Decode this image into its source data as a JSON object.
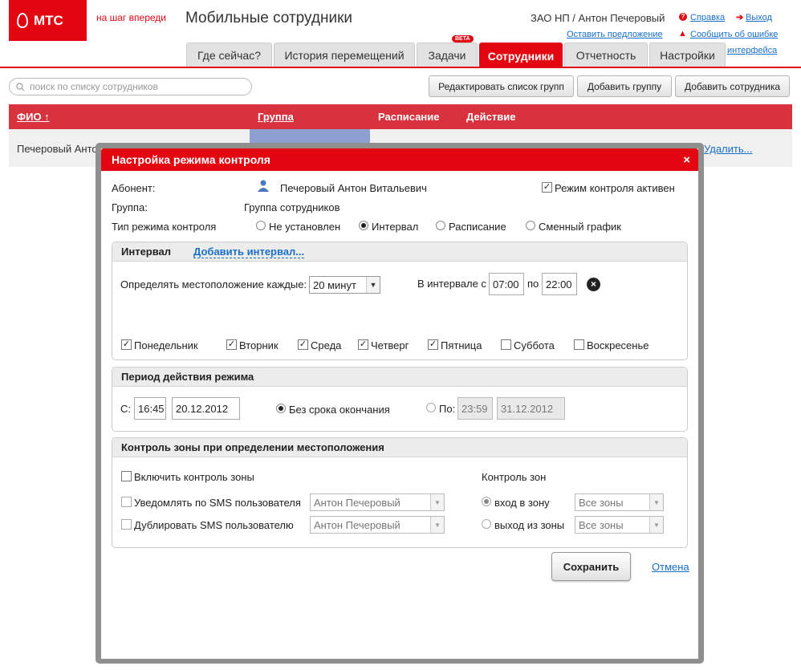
{
  "header": {
    "logo_text": "МТС",
    "slogan": "на шаг впереди",
    "app_title": "Мобильные сотрудники",
    "company_user": "ЗАО НП / Антон Печеровый",
    "help": "Справка",
    "logout": "Выход",
    "suggest": "Оставить предложение",
    "report_error": "Сообщить об ошибке",
    "interface_partial": "интерфейса"
  },
  "tabs": [
    {
      "label": "Где сейчас?"
    },
    {
      "label": "История перемещений"
    },
    {
      "label": "Задачи",
      "badge": "BETA"
    },
    {
      "label": "Сотрудники",
      "active": true
    },
    {
      "label": "Отчетность"
    },
    {
      "label": "Настройки"
    }
  ],
  "toolbar": {
    "search_placeholder": "поиск по списку сотрудников",
    "edit_groups": "Редактировать список групп",
    "add_group": "Добавить группу",
    "add_employee": "Добавить сотрудника"
  },
  "table": {
    "columns": [
      "ФИО ↑",
      "Группа",
      "Расписание",
      "Действие"
    ],
    "row_name_partial": "Печеровый Анто",
    "row_delete": "Удалить..."
  },
  "modal": {
    "title": "Настройка режима контроля",
    "close": "×",
    "subscriber_label": "Абонент:",
    "subscriber_value": "Печеровый Антон Витальевич",
    "group_label": "Группа:",
    "group_value": "Группа сотрудников",
    "mode_active_label": "Режим контроля активен",
    "mode_active_checked": true,
    "mode_type_label": "Тип режима контроля",
    "mode_options": [
      {
        "label": "Не установлен",
        "selected": false
      },
      {
        "label": "Интервал",
        "selected": true
      },
      {
        "label": "Расписание",
        "selected": false
      },
      {
        "label": "Сменный график",
        "selected": false
      }
    ],
    "interval": {
      "title": "Интервал",
      "add_link": "Добавить интервал...",
      "locate_label": "Определять местоположение каждые:",
      "locate_value": "20 минут",
      "range_label": "В интервале с",
      "from": "07:00",
      "to_label": "по",
      "to": "22:00",
      "days": [
        {
          "label": "Понедельник",
          "checked": true
        },
        {
          "label": "Вторник",
          "checked": true
        },
        {
          "label": "Среда",
          "checked": true
        },
        {
          "label": "Четверг",
          "checked": true
        },
        {
          "label": "Пятница",
          "checked": true
        },
        {
          "label": "Суббота",
          "checked": false
        },
        {
          "label": "Воскресенье",
          "checked": false
        }
      ]
    },
    "period": {
      "title": "Период действия режима",
      "from_label": "С:",
      "from_time": "16:45",
      "from_date": "20.12.2012",
      "no_end_label": "Без срока окончания",
      "to_label": "По:",
      "to_time": "23:59",
      "to_date": "31.12.2012"
    },
    "zone": {
      "title": "Контроль зоны при определении местоположения",
      "enable_label": "Включить контроль зоны",
      "notify_sms_label": "Уведомлять по SMS пользователя",
      "notify_sms_user": "Антон Печеровый",
      "dup_sms_label": "Дублировать SMS пользователю",
      "dup_sms_user": "Антон Печеровый",
      "zones_title": "Контроль зон",
      "enter_label": "вход в зону",
      "enter_value": "Все зоны",
      "exit_label": "выход из зоны",
      "exit_value": "Все зоны"
    },
    "save": "Сохранить",
    "cancel": "Отмена"
  }
}
